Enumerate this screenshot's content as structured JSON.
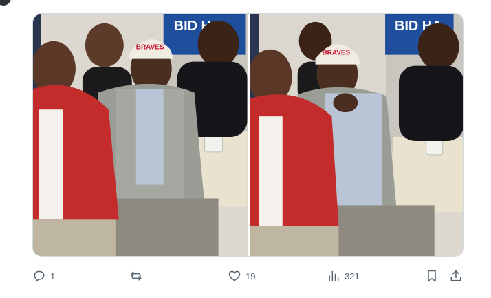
{
  "tweet": {
    "media": [
      {
        "alt": "",
        "banner_text": "BID HA",
        "cap_text": "BRAVES"
      },
      {
        "alt": "",
        "banner_text": "BID HA",
        "cap_text": "BRAVES"
      }
    ],
    "actions": {
      "reply": {
        "icon": "reply-icon",
        "count": "1"
      },
      "repost": {
        "icon": "repost-icon",
        "count": ""
      },
      "like": {
        "icon": "heart-icon",
        "count": "19"
      },
      "views": {
        "icon": "views-chart-icon",
        "count": "321"
      },
      "bookmark": {
        "icon": "bookmark-icon"
      },
      "share": {
        "icon": "share-icon"
      }
    }
  },
  "colors": {
    "icon": "#536471",
    "border": "#cfd9de",
    "banner": "#1f4e9c",
    "accent_red": "#c8102e"
  }
}
